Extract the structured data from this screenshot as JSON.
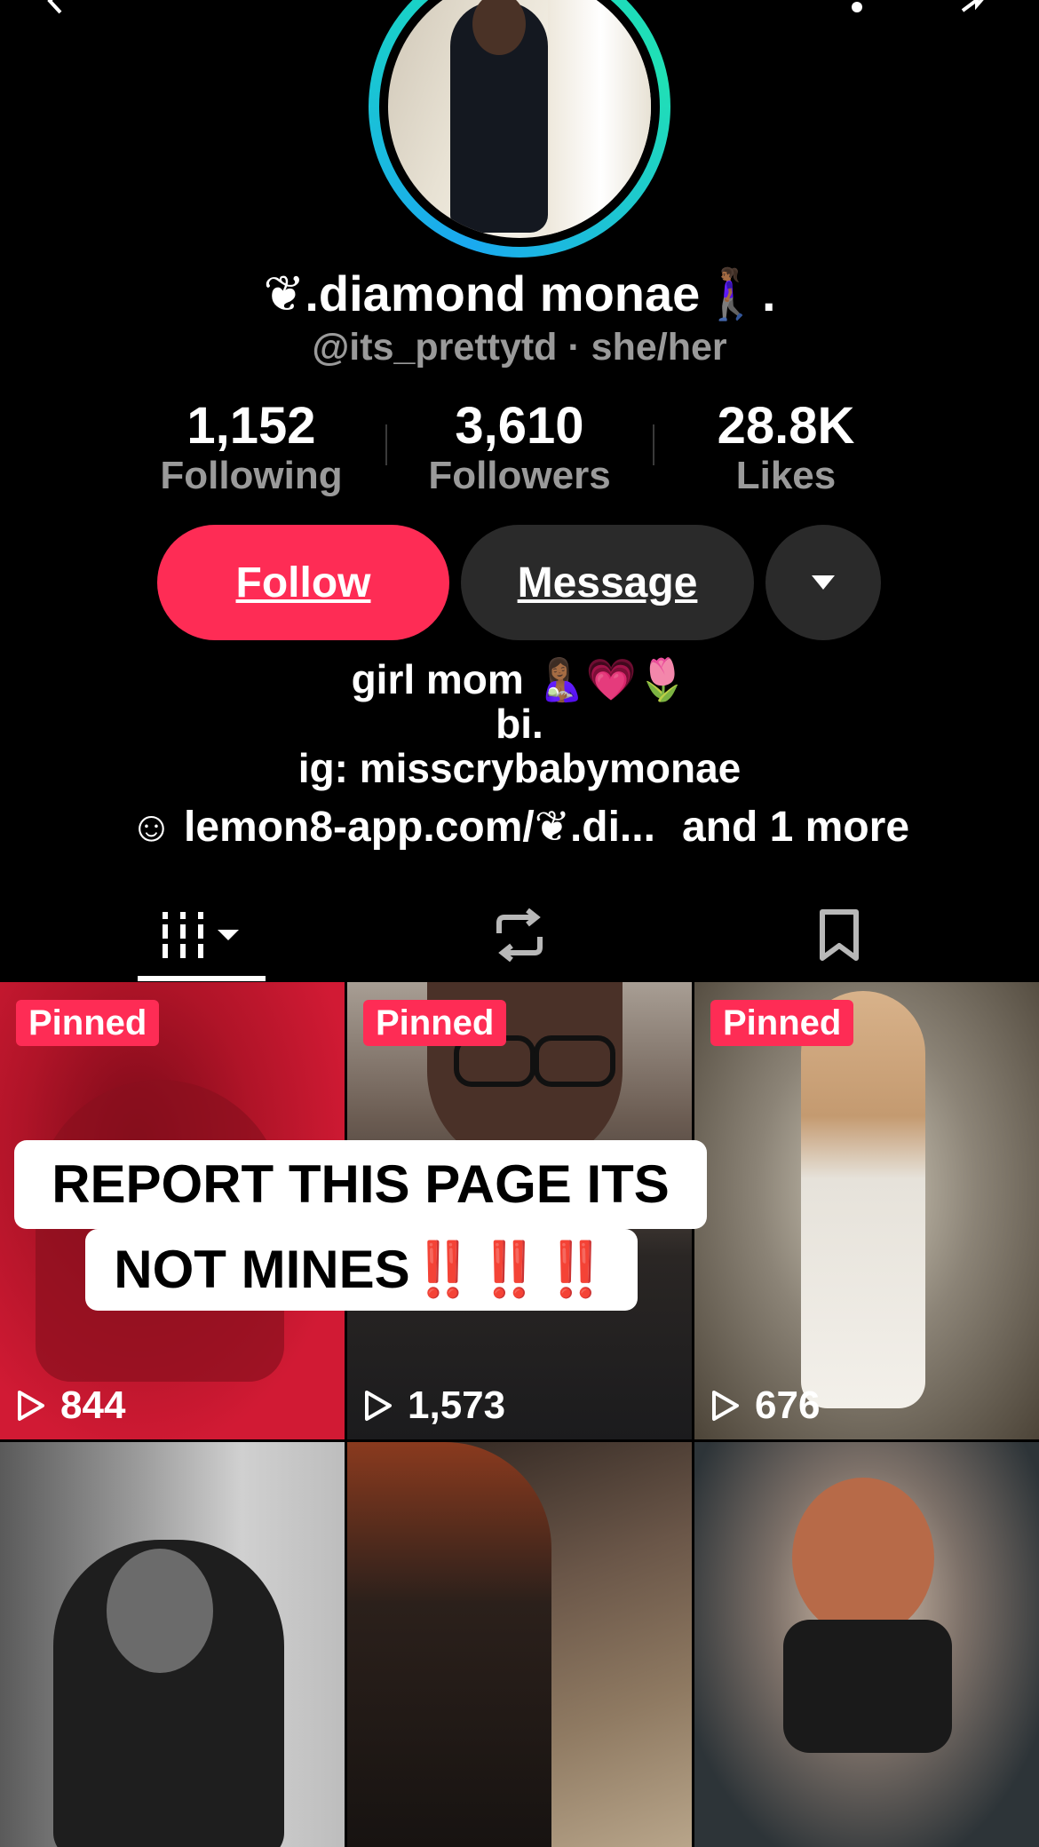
{
  "profile": {
    "display_name": "❦.diamond monae🚶🏾‍♀️.",
    "handle_line": "@its_prettytd · she/her"
  },
  "stats": [
    {
      "value": "1,152",
      "label": "Following"
    },
    {
      "value": "3,610",
      "label": "Followers"
    },
    {
      "value": "28.8K",
      "label": "Likes"
    }
  ],
  "actions": {
    "follow_label": "Follow",
    "message_label": "Message"
  },
  "bio": {
    "line1": "girl mom 🤱🏾💗🌷",
    "line2": "bi.",
    "line3": "ig: misscrybabymonae",
    "link_icon": "☺",
    "link_text": "lemon8-app.com/❦.di...",
    "link_more": "and 1 more"
  },
  "tabs": [
    {
      "icon": "grid-icon",
      "active": true
    },
    {
      "icon": "repost-icon",
      "active": false
    },
    {
      "icon": "bookmark-icon",
      "active": false
    }
  ],
  "videos": [
    {
      "pinned_label": "Pinned",
      "views": "844"
    },
    {
      "pinned_label": "Pinned",
      "views": "1,573"
    },
    {
      "pinned_label": "Pinned",
      "views": "676"
    },
    {
      "pinned_label": "",
      "views": ""
    },
    {
      "pinned_label": "",
      "views": ""
    },
    {
      "pinned_label": "",
      "views": ""
    }
  ],
  "overlay_caption": {
    "line1": "REPORT THIS PAGE ITS",
    "line2": "NOT MINES",
    "emphasis": "‼️‼️‼️"
  },
  "colors": {
    "accent": "#fe2c55",
    "background": "#000000",
    "secondary_text": "#9a9a9a",
    "button_dark": "#2a2a2a",
    "ring_start": "#1aa9f0",
    "ring_end": "#20e0b5"
  }
}
